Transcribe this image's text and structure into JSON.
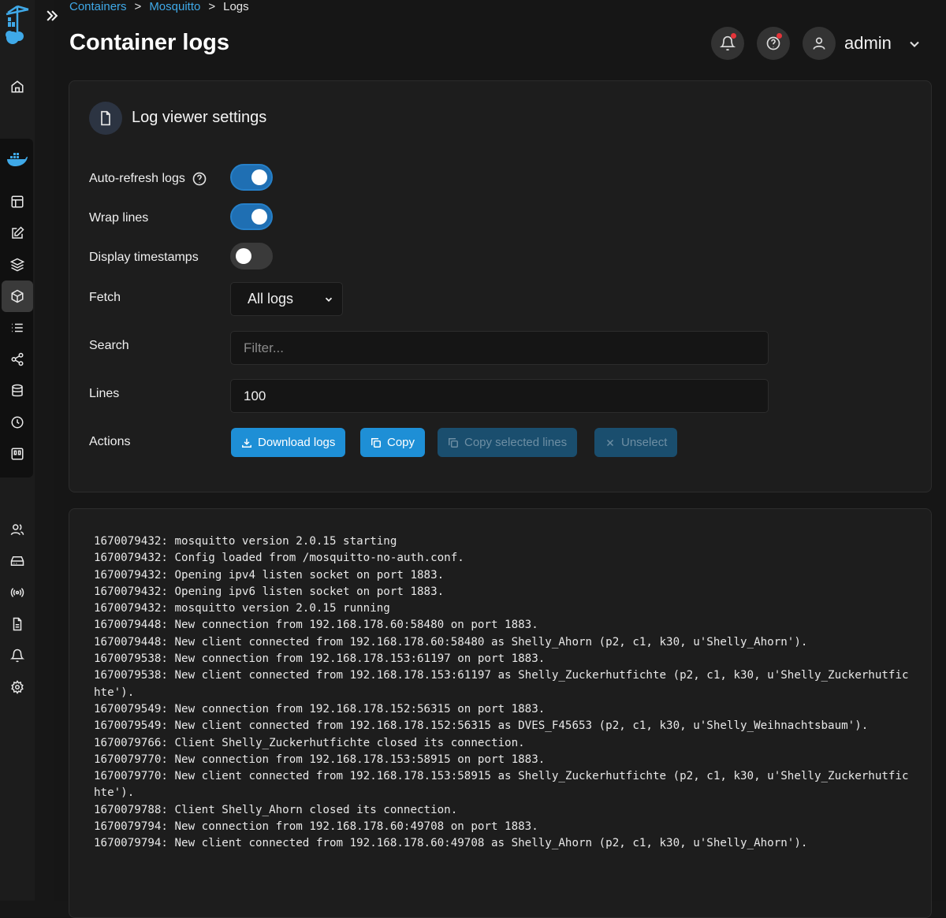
{
  "breadcrumb": {
    "item1": "Containers",
    "sep1": ">",
    "item2": "Mosquitto",
    "sep2": ">",
    "item3": "Logs"
  },
  "page_title": "Container logs",
  "header": {
    "user": "admin"
  },
  "settings": {
    "title": "Log viewer settings",
    "auto_refresh_label": "Auto-refresh logs",
    "auto_refresh": true,
    "wrap_label": "Wrap lines",
    "wrap": true,
    "timestamps_label": "Display timestamps",
    "timestamps": false,
    "fetch_label": "Fetch",
    "fetch_value": "All logs",
    "search_label": "Search",
    "search_placeholder": "Filter...",
    "lines_label": "Lines",
    "lines_value": "100",
    "actions_label": "Actions",
    "download_label": "Download logs",
    "copy_label": "Copy",
    "copy_selected_label": "Copy selected lines",
    "unselect_label": "Unselect"
  },
  "logs": [
    "1670079432: mosquitto version 2.0.15 starting",
    "1670079432: Config loaded from /mosquitto-no-auth.conf.",
    "1670079432: Opening ipv4 listen socket on port 1883.",
    "1670079432: Opening ipv6 listen socket on port 1883.",
    "1670079432: mosquitto version 2.0.15 running",
    "1670079448: New connection from 192.168.178.60:58480 on port 1883.",
    "1670079448: New client connected from 192.168.178.60:58480 as Shelly_Ahorn (p2, c1, k30, u'Shelly_Ahorn').",
    "1670079538: New connection from 192.168.178.153:61197 on port 1883.",
    "1670079538: New client connected from 192.168.178.153:61197 as Shelly_Zuckerhutfichte (p2, c1, k30, u'Shelly_Zuckerhutfichte').",
    "1670079549: New connection from 192.168.178.152:56315 on port 1883.",
    "1670079549: New client connected from 192.168.178.152:56315 as DVES_F45653 (p2, c1, k30, u'Shelly_Weihnachtsbaum').",
    "1670079766: Client Shelly_Zuckerhutfichte closed its connection.",
    "1670079770: New connection from 192.168.178.153:58915 on port 1883.",
    "1670079770: New client connected from 192.168.178.153:58915 as Shelly_Zuckerhutfichte (p2, c1, k30, u'Shelly_Zuckerhutfichte').",
    "1670079788: Client Shelly_Ahorn closed its connection.",
    "1670079794: New connection from 192.168.178.60:49708 on port 1883.",
    "1670079794: New client connected from 192.168.178.60:49708 as Shelly_Ahorn (p2, c1, k30, u'Shelly_Ahorn')."
  ]
}
